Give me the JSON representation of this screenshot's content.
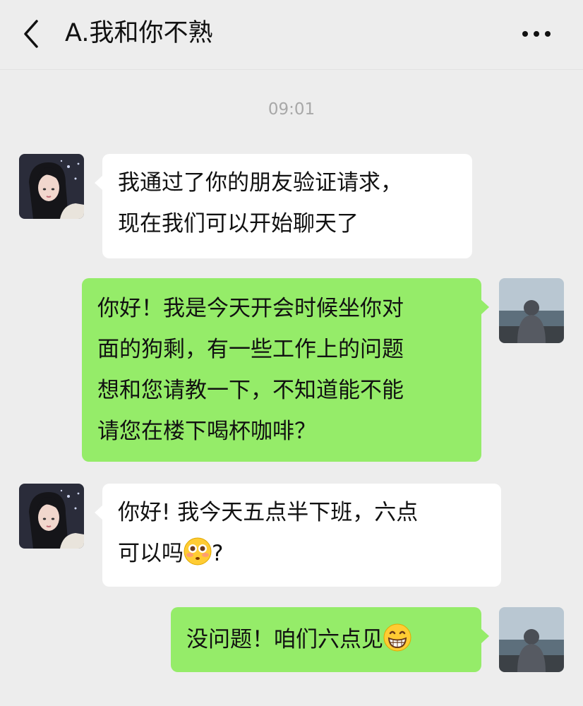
{
  "header": {
    "title": "A.我和你不熟",
    "back_icon": "chevron-left-icon",
    "more_icon": "more-dots-icon"
  },
  "timestamp": "09:01",
  "messages": [
    {
      "side": "in",
      "lines": [
        "我通过了你的朋友验证请求，",
        "现在我们可以开始聊天了"
      ]
    },
    {
      "side": "out",
      "lines": [
        "你好！我是今天开会时候坐你对",
        "面的狗剩，有一些工作上的问题",
        "想和您请教一下，不知道能不能",
        "请您在楼下喝杯咖啡？"
      ]
    },
    {
      "side": "in",
      "lines": [
        "你好! 我今天五点半下班，六点",
        "可以吗"
      ],
      "line2_suffix": "?",
      "emoji": "flushed-face-emoji"
    },
    {
      "side": "out",
      "lines": [
        "没问题！咱们六点见"
      ],
      "emoji": "grinning-face-emoji"
    }
  ],
  "colors": {
    "background": "#ededed",
    "outgoing_bubble": "#95ec69",
    "incoming_bubble": "#ffffff",
    "timestamp": "#a8a8a8"
  }
}
